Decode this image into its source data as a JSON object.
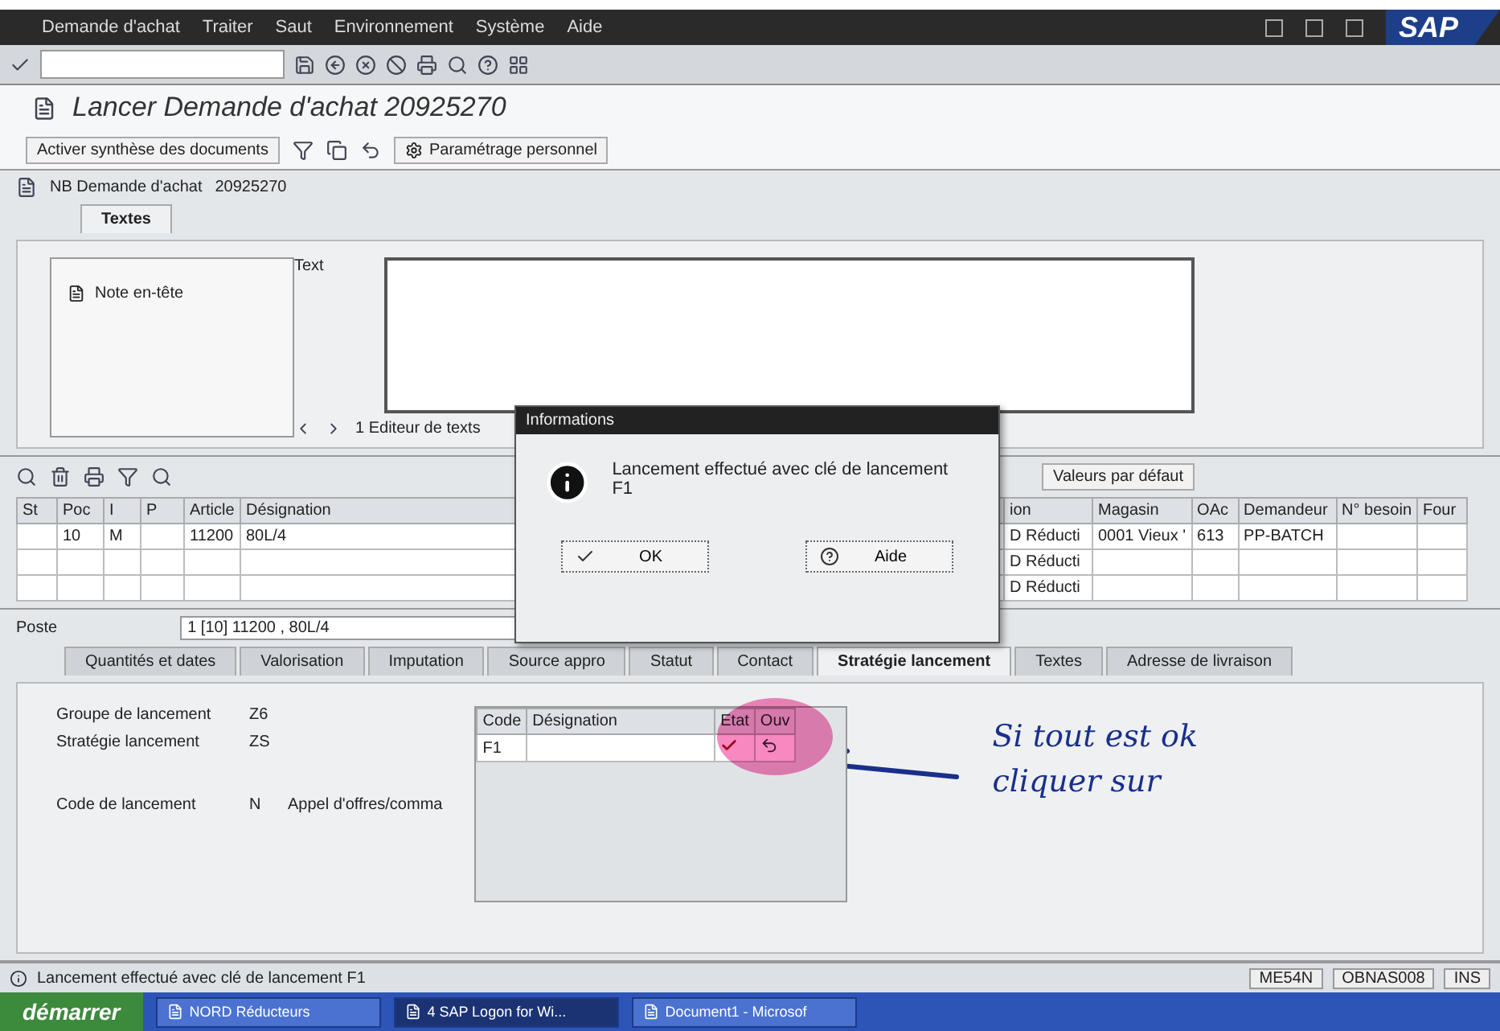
{
  "menu_bar": {
    "items": [
      "Demande d'achat",
      "Traiter",
      "Saut",
      "Environnement",
      "Système",
      "Aide"
    ],
    "logo": "SAP"
  },
  "title": "Lancer Demande d'achat 20925270",
  "app_toolbar": {
    "synthesis_button": "Activer synthèse des documents",
    "settings_button": "Paramétrage personnel"
  },
  "header": {
    "doc_type": "NB Demande d'achat",
    "number": "20925270",
    "tabs": [
      {
        "label": "Textes",
        "selected": true
      }
    ],
    "text_types": [
      "Note en-tête"
    ],
    "text_label": "Text",
    "editor_label": "1 Editeur de texts"
  },
  "items": {
    "default_values_button": "Valeurs par défaut",
    "columns_left": [
      "St",
      "Poc",
      "I",
      "P",
      "Article",
      "Désignation"
    ],
    "columns_right": [
      "ion",
      "Magasin",
      "OAc",
      "Demandeur",
      "N° besoin",
      "Four"
    ],
    "rows": [
      {
        "cells": [
          null,
          "10",
          "M",
          null,
          "11200",
          "80L/4",
          "D Réducti",
          "0001 Vieux '",
          "613",
          "PP-BATCH",
          null,
          null
        ]
      },
      {
        "cells": [
          null,
          null,
          null,
          null,
          null,
          null,
          "D Réducti",
          null,
          null,
          null,
          null,
          null
        ]
      },
      {
        "cells": [
          null,
          null,
          null,
          null,
          null,
          null,
          "D Réducti",
          null,
          null,
          null,
          null,
          null
        ]
      }
    ]
  },
  "dialog": {
    "title": "Informations",
    "message": "Lancement effectué avec clé de lancement F1",
    "buttons": [
      {
        "kind": "ok",
        "label": "OK"
      },
      {
        "kind": "help",
        "label": "Aide"
      }
    ]
  },
  "poste": {
    "label": "Poste",
    "value": "1 [10] 11200 , 80L/4",
    "tabs": [
      {
        "label": "Quantités et dates",
        "selected": false
      },
      {
        "label": "Valorisation",
        "selected": false
      },
      {
        "label": "Imputation",
        "selected": false
      },
      {
        "label": "Source appro",
        "selected": false
      },
      {
        "label": "Statut",
        "selected": false
      },
      {
        "label": "Contact",
        "selected": false
      },
      {
        "label": "Stratégie lancement",
        "selected": true
      },
      {
        "label": "Textes",
        "selected": false
      },
      {
        "label": "Adresse de livraison",
        "selected": false
      }
    ],
    "fields": [
      {
        "label": "Groupe de lancement",
        "value": "Z6"
      },
      {
        "label": "Stratégie lancement",
        "value": "ZS"
      },
      {
        "label": "Code de lancement",
        "value": "N",
        "description": "Appel d'offres/comma"
      }
    ],
    "release_table": {
      "columns": [
        "Code",
        "Désignation",
        "Etat",
        "Ouv"
      ],
      "rows": [
        {
          "code": "F1",
          "released": true
        }
      ]
    }
  },
  "annotation": {
    "lines": [
      "Si tout est ok",
      "cliquer sur"
    ]
  },
  "status_bar": {
    "message": "Lancement effectué avec clé de lancement F1",
    "transaction": "ME54N",
    "server": "OBNAS008",
    "mode": "INS"
  },
  "taskbar": {
    "start": "démarrer",
    "tasks": [
      {
        "label": "NORD Réducteurs",
        "selected": false
      },
      {
        "label": "4 SAP Logon for Wi...",
        "selected": true
      },
      {
        "label": "Document1 - Microsof",
        "selected": false
      }
    ]
  }
}
